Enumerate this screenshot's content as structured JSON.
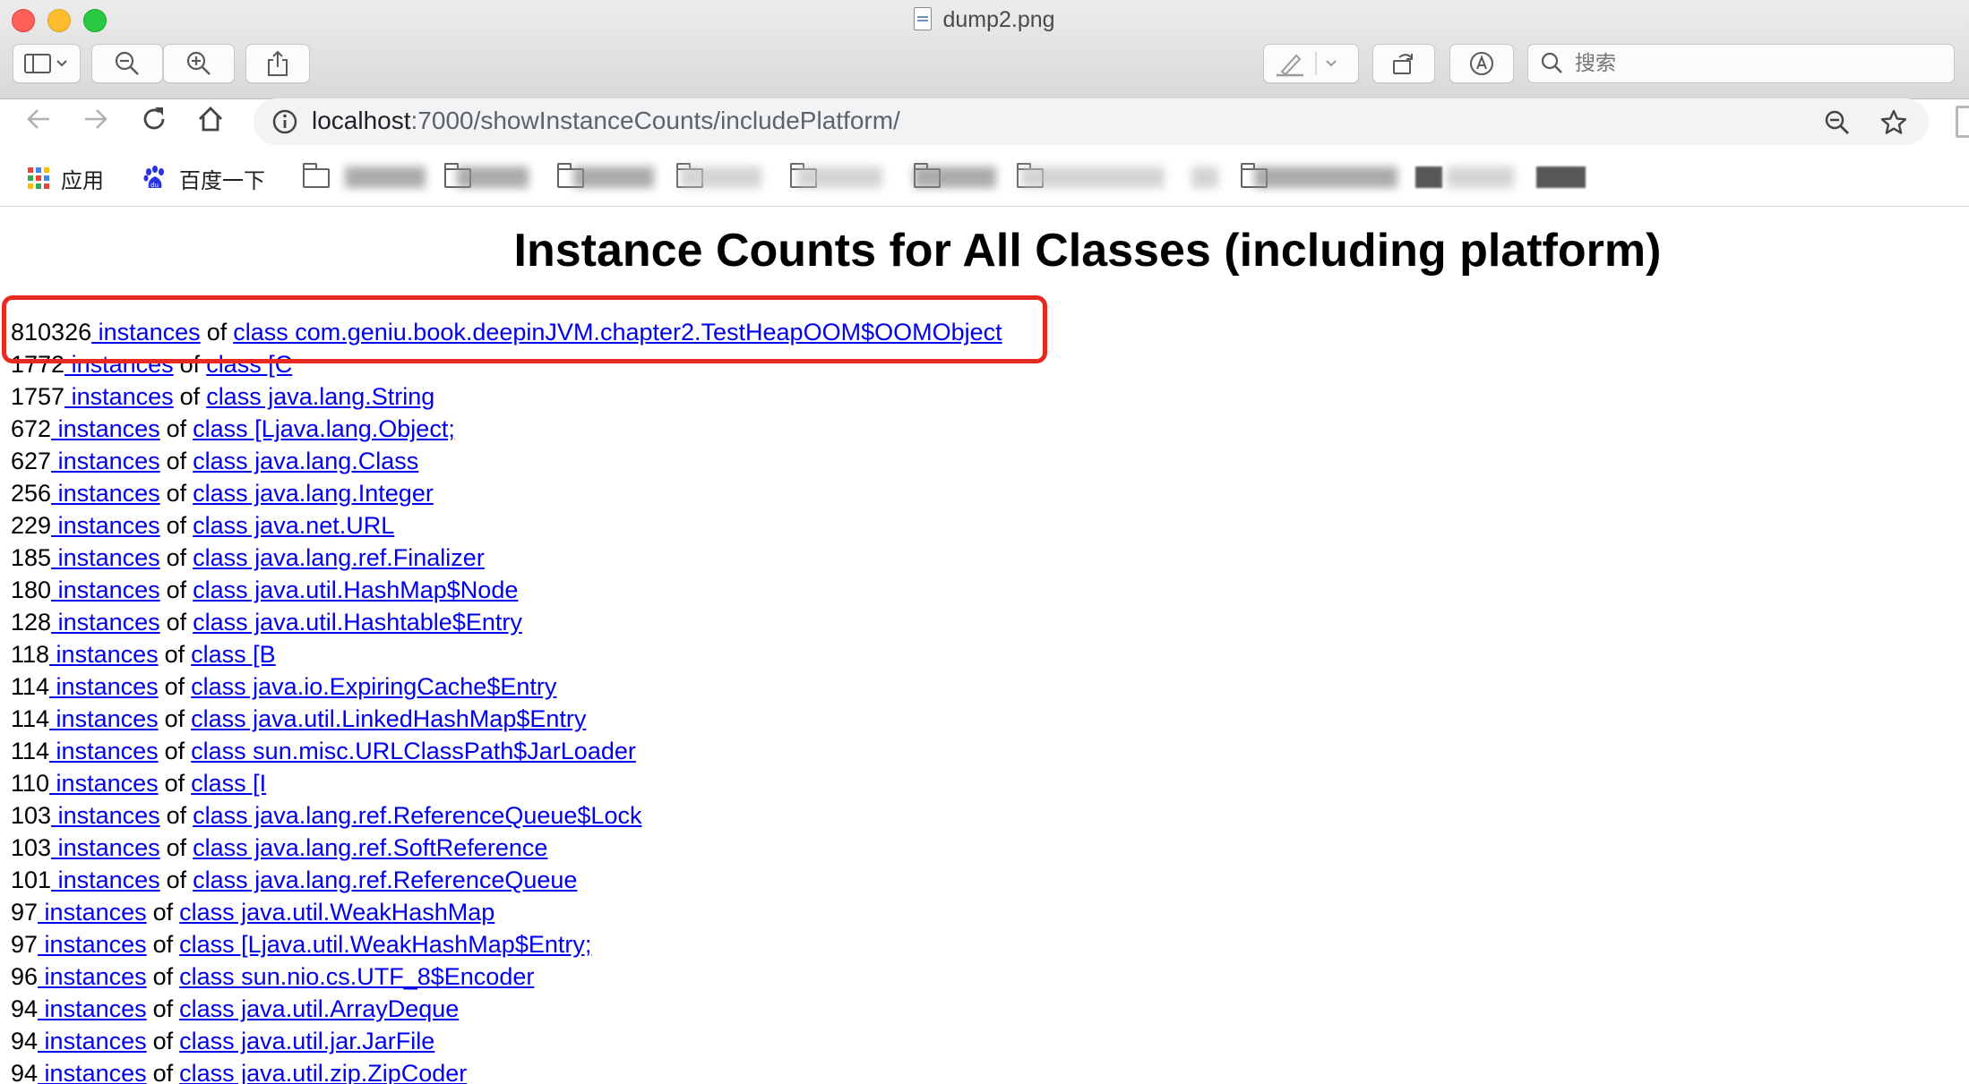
{
  "window": {
    "title": "dump2.png",
    "search_placeholder": "搜索"
  },
  "browser": {
    "url_host": "localhost",
    "url_path": ":7000/showInstanceCounts/includePlatform/",
    "bookmarks": [
      {
        "label": "应用",
        "icon": "apps-grid-icon"
      },
      {
        "label": "百度一下",
        "icon": "baidu-paw-icon"
      }
    ]
  },
  "page": {
    "title": "Instance Counts for All Classes (including platform)",
    "of_text": "of",
    "rows": [
      {
        "count": "810326",
        "instances": " instances",
        "class": "class com.geniu.book.deepinJVM.chapter2.TestHeapOOM$OOMObject"
      },
      {
        "count": "1772",
        "instances": " instances",
        "class": "class [C"
      },
      {
        "count": "1757",
        "instances": " instances",
        "class": "class java.lang.String"
      },
      {
        "count": "672",
        "instances": " instances",
        "class": "class [Ljava.lang.Object;"
      },
      {
        "count": "627",
        "instances": " instances",
        "class": "class java.lang.Class"
      },
      {
        "count": "256",
        "instances": " instances",
        "class": "class java.lang.Integer"
      },
      {
        "count": "229",
        "instances": " instances",
        "class": "class java.net.URL"
      },
      {
        "count": "185",
        "instances": " instances",
        "class": "class java.lang.ref.Finalizer"
      },
      {
        "count": "180",
        "instances": " instances",
        "class": "class java.util.HashMap$Node"
      },
      {
        "count": "128",
        "instances": " instances",
        "class": "class java.util.Hashtable$Entry"
      },
      {
        "count": "118",
        "instances": " instances",
        "class": "class [B"
      },
      {
        "count": "114",
        "instances": " instances",
        "class": "class java.io.ExpiringCache$Entry"
      },
      {
        "count": "114",
        "instances": " instances",
        "class": "class java.util.LinkedHashMap$Entry"
      },
      {
        "count": "114",
        "instances": " instances",
        "class": "class sun.misc.URLClassPath$JarLoader"
      },
      {
        "count": "110",
        "instances": " instances",
        "class": "class [I"
      },
      {
        "count": "103",
        "instances": " instances",
        "class": "class java.lang.ref.ReferenceQueue$Lock"
      },
      {
        "count": "103",
        "instances": " instances",
        "class": "class java.lang.ref.SoftReference"
      },
      {
        "count": "101",
        "instances": " instances",
        "class": "class java.lang.ref.ReferenceQueue"
      },
      {
        "count": "97",
        "instances": " instances",
        "class": "class java.util.WeakHashMap"
      },
      {
        "count": "97",
        "instances": " instances",
        "class": "class [Ljava.util.WeakHashMap$Entry;"
      },
      {
        "count": "96",
        "instances": " instances",
        "class": "class sun.nio.cs.UTF_8$Encoder"
      },
      {
        "count": "94",
        "instances": " instances",
        "class": "class java.util.ArrayDeque"
      },
      {
        "count": "94",
        "instances": " instances",
        "class": "class java.util.jar.JarFile"
      },
      {
        "count": "94",
        "instances": " instances",
        "class": "class java.util.zip.ZipCoder"
      }
    ]
  },
  "colors": {
    "link": "#0000ee",
    "highlight_border": "#e8291f"
  }
}
